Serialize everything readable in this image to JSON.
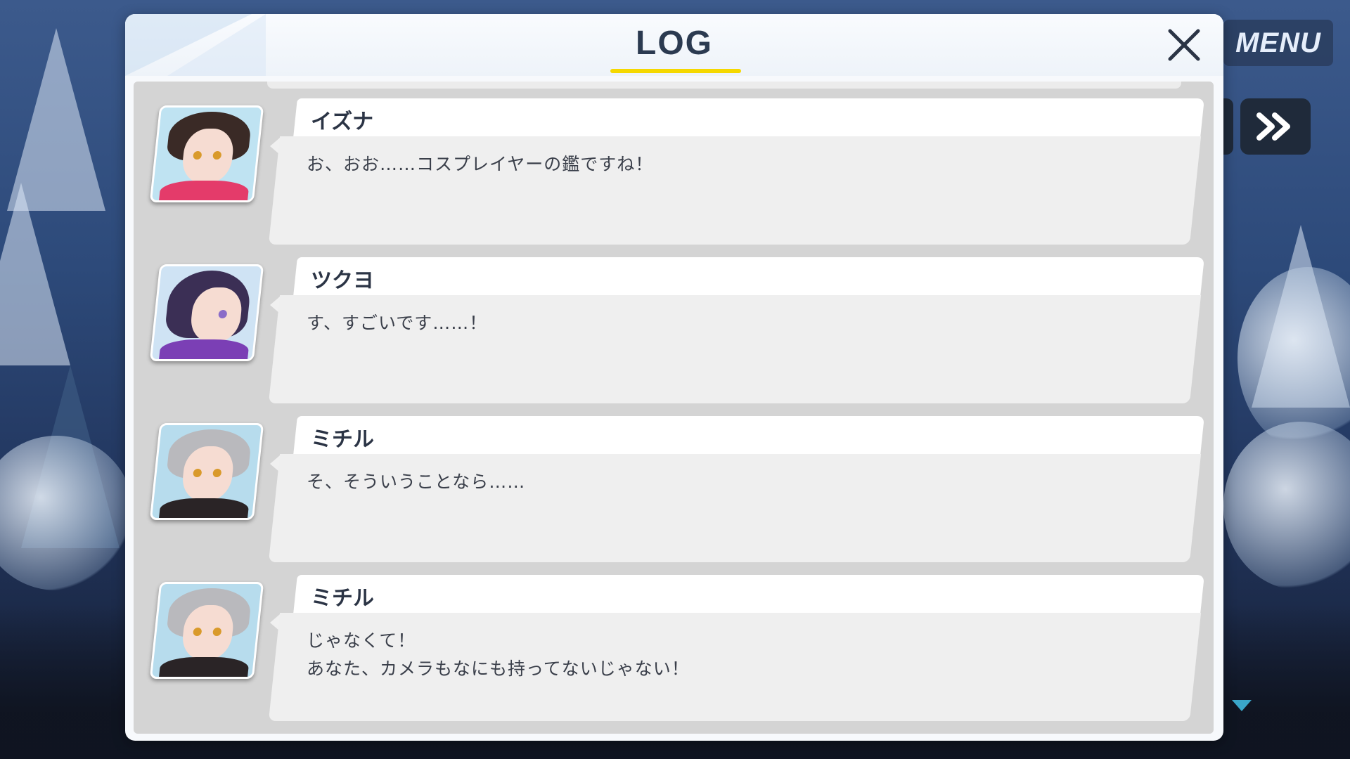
{
  "header": {
    "title": "LOG"
  },
  "controls": {
    "menu_label": "MENU"
  },
  "entries": [
    {
      "name": "イズナ",
      "lines": [
        "お、おお……コスプレイヤーの鑑ですね！"
      ],
      "hair": "#3a2a26",
      "cloth": "#e43b6a",
      "bg": "#bfe3f2"
    },
    {
      "name": "ツクヨ",
      "lines": [
        "す、すごいです……！"
      ],
      "hair": "#3b2f55",
      "cloth": "#7b3fb5",
      "bg": "#cfe3f4"
    },
    {
      "name": "ミチル",
      "lines": [
        "そ、そういうことなら……"
      ],
      "hair": "#b9b9bd",
      "cloth": "#2a2426",
      "bg": "#b7dced"
    },
    {
      "name": "ミチル",
      "lines": [
        "じゃなくて！",
        "あなた、カメラもなにも持ってないじゃない！"
      ],
      "hair": "#b9b9bd",
      "cloth": "#2a2426",
      "bg": "#b7dced"
    }
  ],
  "colors": {
    "title_underline": "#f5d800",
    "scroll_arrow": "#3aa6c9"
  }
}
